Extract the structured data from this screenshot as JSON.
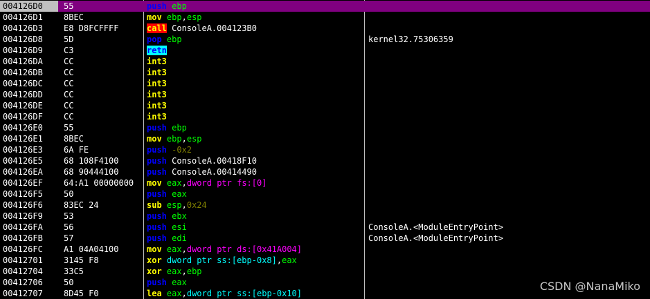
{
  "listing": {
    "rows": [
      {
        "addr": "004126D0",
        "bytes": "55",
        "comment": "",
        "selected": true,
        "asm": [
          {
            "t": "push",
            "c": "push"
          },
          {
            "t": " ",
            "c": "pun"
          },
          {
            "t": "ebp",
            "c": "reg"
          }
        ]
      },
      {
        "addr": "004126D1",
        "bytes": "8BEC",
        "comment": "",
        "asm": [
          {
            "t": "mov",
            "c": "mov"
          },
          {
            "t": " ",
            "c": "pun"
          },
          {
            "t": "ebp",
            "c": "reg"
          },
          {
            "t": ",",
            "c": "pun"
          },
          {
            "t": "esp",
            "c": "reg"
          }
        ]
      },
      {
        "addr": "004126D3",
        "bytes": "E8 D8FCFFFF",
        "comment": "",
        "asm": [
          {
            "t": "call",
            "c": "call"
          },
          {
            "t": " ConsoleA.004123B0",
            "c": "sym"
          }
        ]
      },
      {
        "addr": "004126D8",
        "bytes": "5D",
        "comment": "kernel32.75306359",
        "asm": [
          {
            "t": "pop",
            "c": "pop"
          },
          {
            "t": " ",
            "c": "pun"
          },
          {
            "t": "ebp",
            "c": "reg"
          }
        ]
      },
      {
        "addr": "004126D9",
        "bytes": "C3",
        "comment": "",
        "asm": [
          {
            "t": "retn",
            "c": "retn"
          }
        ]
      },
      {
        "addr": "004126DA",
        "bytes": "CC",
        "comment": "",
        "asm": [
          {
            "t": "int3",
            "c": "int"
          }
        ]
      },
      {
        "addr": "004126DB",
        "bytes": "CC",
        "comment": "",
        "asm": [
          {
            "t": "int3",
            "c": "int"
          }
        ]
      },
      {
        "addr": "004126DC",
        "bytes": "CC",
        "comment": "",
        "asm": [
          {
            "t": "int3",
            "c": "int"
          }
        ]
      },
      {
        "addr": "004126DD",
        "bytes": "CC",
        "comment": "",
        "asm": [
          {
            "t": "int3",
            "c": "int"
          }
        ]
      },
      {
        "addr": "004126DE",
        "bytes": "CC",
        "comment": "",
        "asm": [
          {
            "t": "int3",
            "c": "int"
          }
        ]
      },
      {
        "addr": "004126DF",
        "bytes": "CC",
        "comment": "",
        "asm": [
          {
            "t": "int3",
            "c": "int"
          }
        ]
      },
      {
        "addr": "004126E0",
        "bytes": "55",
        "comment": "",
        "asm": [
          {
            "t": "push",
            "c": "push"
          },
          {
            "t": " ",
            "c": "pun"
          },
          {
            "t": "ebp",
            "c": "reg"
          }
        ]
      },
      {
        "addr": "004126E1",
        "bytes": "8BEC",
        "comment": "",
        "asm": [
          {
            "t": "mov",
            "c": "mov"
          },
          {
            "t": " ",
            "c": "pun"
          },
          {
            "t": "ebp",
            "c": "reg"
          },
          {
            "t": ",",
            "c": "pun"
          },
          {
            "t": "esp",
            "c": "reg"
          }
        ]
      },
      {
        "addr": "004126E3",
        "bytes": "6A FE",
        "comment": "",
        "asm": [
          {
            "t": "push",
            "c": "push"
          },
          {
            "t": " -0x2",
            "c": "num"
          }
        ]
      },
      {
        "addr": "004126E5",
        "bytes": "68 108F4100",
        "comment": "",
        "asm": [
          {
            "t": "push",
            "c": "push"
          },
          {
            "t": " ConsoleA.00418F10",
            "c": "sym"
          }
        ]
      },
      {
        "addr": "004126EA",
        "bytes": "68 90444100",
        "comment": "",
        "asm": [
          {
            "t": "push",
            "c": "push"
          },
          {
            "t": " ConsoleA.00414490",
            "c": "sym"
          }
        ]
      },
      {
        "addr": "004126EF",
        "bytes": "64:A1 00000000",
        "comment": "",
        "asm": [
          {
            "t": "mov",
            "c": "mov"
          },
          {
            "t": " ",
            "c": "pun"
          },
          {
            "t": "eax",
            "c": "reg"
          },
          {
            "t": ",",
            "c": "pun"
          },
          {
            "t": "dword ptr fs:[0]",
            "c": "mem"
          }
        ]
      },
      {
        "addr": "004126F5",
        "bytes": "50",
        "comment": "",
        "asm": [
          {
            "t": "push",
            "c": "push"
          },
          {
            "t": " ",
            "c": "pun"
          },
          {
            "t": "eax",
            "c": "reg"
          }
        ]
      },
      {
        "addr": "004126F6",
        "bytes": "83EC 24",
        "comment": "",
        "asm": [
          {
            "t": "sub",
            "c": "sub"
          },
          {
            "t": " ",
            "c": "pun"
          },
          {
            "t": "esp",
            "c": "reg"
          },
          {
            "t": ",",
            "c": "pun"
          },
          {
            "t": "0x24",
            "c": "num"
          }
        ]
      },
      {
        "addr": "004126F9",
        "bytes": "53",
        "comment": "",
        "asm": [
          {
            "t": "push",
            "c": "push"
          },
          {
            "t": " ",
            "c": "pun"
          },
          {
            "t": "ebx",
            "c": "reg"
          }
        ]
      },
      {
        "addr": "004126FA",
        "bytes": "56",
        "comment": "ConsoleA.<ModuleEntryPoint>",
        "asm": [
          {
            "t": "push",
            "c": "push"
          },
          {
            "t": " ",
            "c": "pun"
          },
          {
            "t": "esi",
            "c": "reg"
          }
        ]
      },
      {
        "addr": "004126FB",
        "bytes": "57",
        "comment": "ConsoleA.<ModuleEntryPoint>",
        "asm": [
          {
            "t": "push",
            "c": "push"
          },
          {
            "t": " ",
            "c": "pun"
          },
          {
            "t": "edi",
            "c": "reg"
          }
        ]
      },
      {
        "addr": "004126FC",
        "bytes": "A1 04A04100",
        "comment": "",
        "asm": [
          {
            "t": "mov",
            "c": "mov"
          },
          {
            "t": " ",
            "c": "pun"
          },
          {
            "t": "eax",
            "c": "reg"
          },
          {
            "t": ",",
            "c": "pun"
          },
          {
            "t": "dword ptr ds:[0x41A004]",
            "c": "mem"
          }
        ]
      },
      {
        "addr": "00412701",
        "bytes": "3145 F8",
        "comment": "",
        "asm": [
          {
            "t": "xor",
            "c": "xor"
          },
          {
            "t": " ",
            "c": "pun"
          },
          {
            "t": "dword ptr ss:[ebp-0x8]",
            "c": "mem2"
          },
          {
            "t": ",",
            "c": "pun"
          },
          {
            "t": "eax",
            "c": "reg"
          }
        ]
      },
      {
        "addr": "00412704",
        "bytes": "33C5",
        "comment": "",
        "asm": [
          {
            "t": "xor",
            "c": "xor"
          },
          {
            "t": " ",
            "c": "pun"
          },
          {
            "t": "eax",
            "c": "reg"
          },
          {
            "t": ",",
            "c": "pun"
          },
          {
            "t": "ebp",
            "c": "reg"
          }
        ]
      },
      {
        "addr": "00412706",
        "bytes": "50",
        "comment": "",
        "asm": [
          {
            "t": "push",
            "c": "push"
          },
          {
            "t": " ",
            "c": "pun"
          },
          {
            "t": "eax",
            "c": "reg"
          }
        ]
      },
      {
        "addr": "00412707",
        "bytes": "8D45 F0",
        "comment": "",
        "asm": [
          {
            "t": "lea",
            "c": "lea"
          },
          {
            "t": " ",
            "c": "pun"
          },
          {
            "t": "eax",
            "c": "reg"
          },
          {
            "t": ",",
            "c": "pun"
          },
          {
            "t": "dword ptr ss:[ebp-0x10]",
            "c": "mem2"
          }
        ]
      }
    ]
  },
  "watermark": "CSDN @NanaMiko",
  "colors": {
    "background": "#000000",
    "selection": "#800080",
    "call_highlight": "#ff0000",
    "retn_highlight": "#00ffff",
    "mnemonic": "#ffff00",
    "stack_op": "#0000ff",
    "register": "#00ff00",
    "memory_operand": "#ff00ff",
    "stack_memory": "#00ffff",
    "immediate": "#808000"
  }
}
